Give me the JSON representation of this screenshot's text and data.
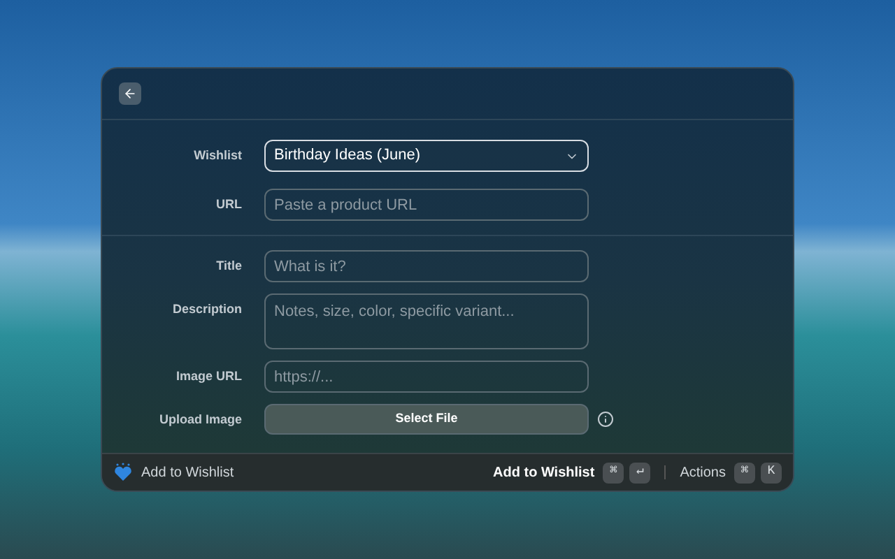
{
  "sections": [
    {
      "fields": [
        {
          "kind": "select",
          "label": "Wishlist",
          "value": "Birthday Ideas (June)",
          "focused": true
        },
        {
          "kind": "text",
          "label": "URL",
          "placeholder": "Paste a product URL",
          "focused": false
        }
      ]
    },
    {
      "fields": [
        {
          "kind": "text",
          "label": "Title",
          "placeholder": "What is it?",
          "focused": false
        },
        {
          "kind": "textarea",
          "label": "Description",
          "placeholder": "Notes, size, color, specific variant...",
          "focused": false
        },
        {
          "kind": "text",
          "label": "Image URL",
          "placeholder": "https://...",
          "focused": false
        },
        {
          "kind": "file",
          "label": "Upload Image",
          "button": "Select File"
        }
      ]
    }
  ],
  "footer": {
    "title": "Add to Wishlist",
    "primary_action": "Add to Wishlist",
    "primary_keys": [
      "⌘",
      "↵"
    ],
    "actions_label": "Actions",
    "actions_keys": [
      "⌘",
      "K"
    ]
  }
}
